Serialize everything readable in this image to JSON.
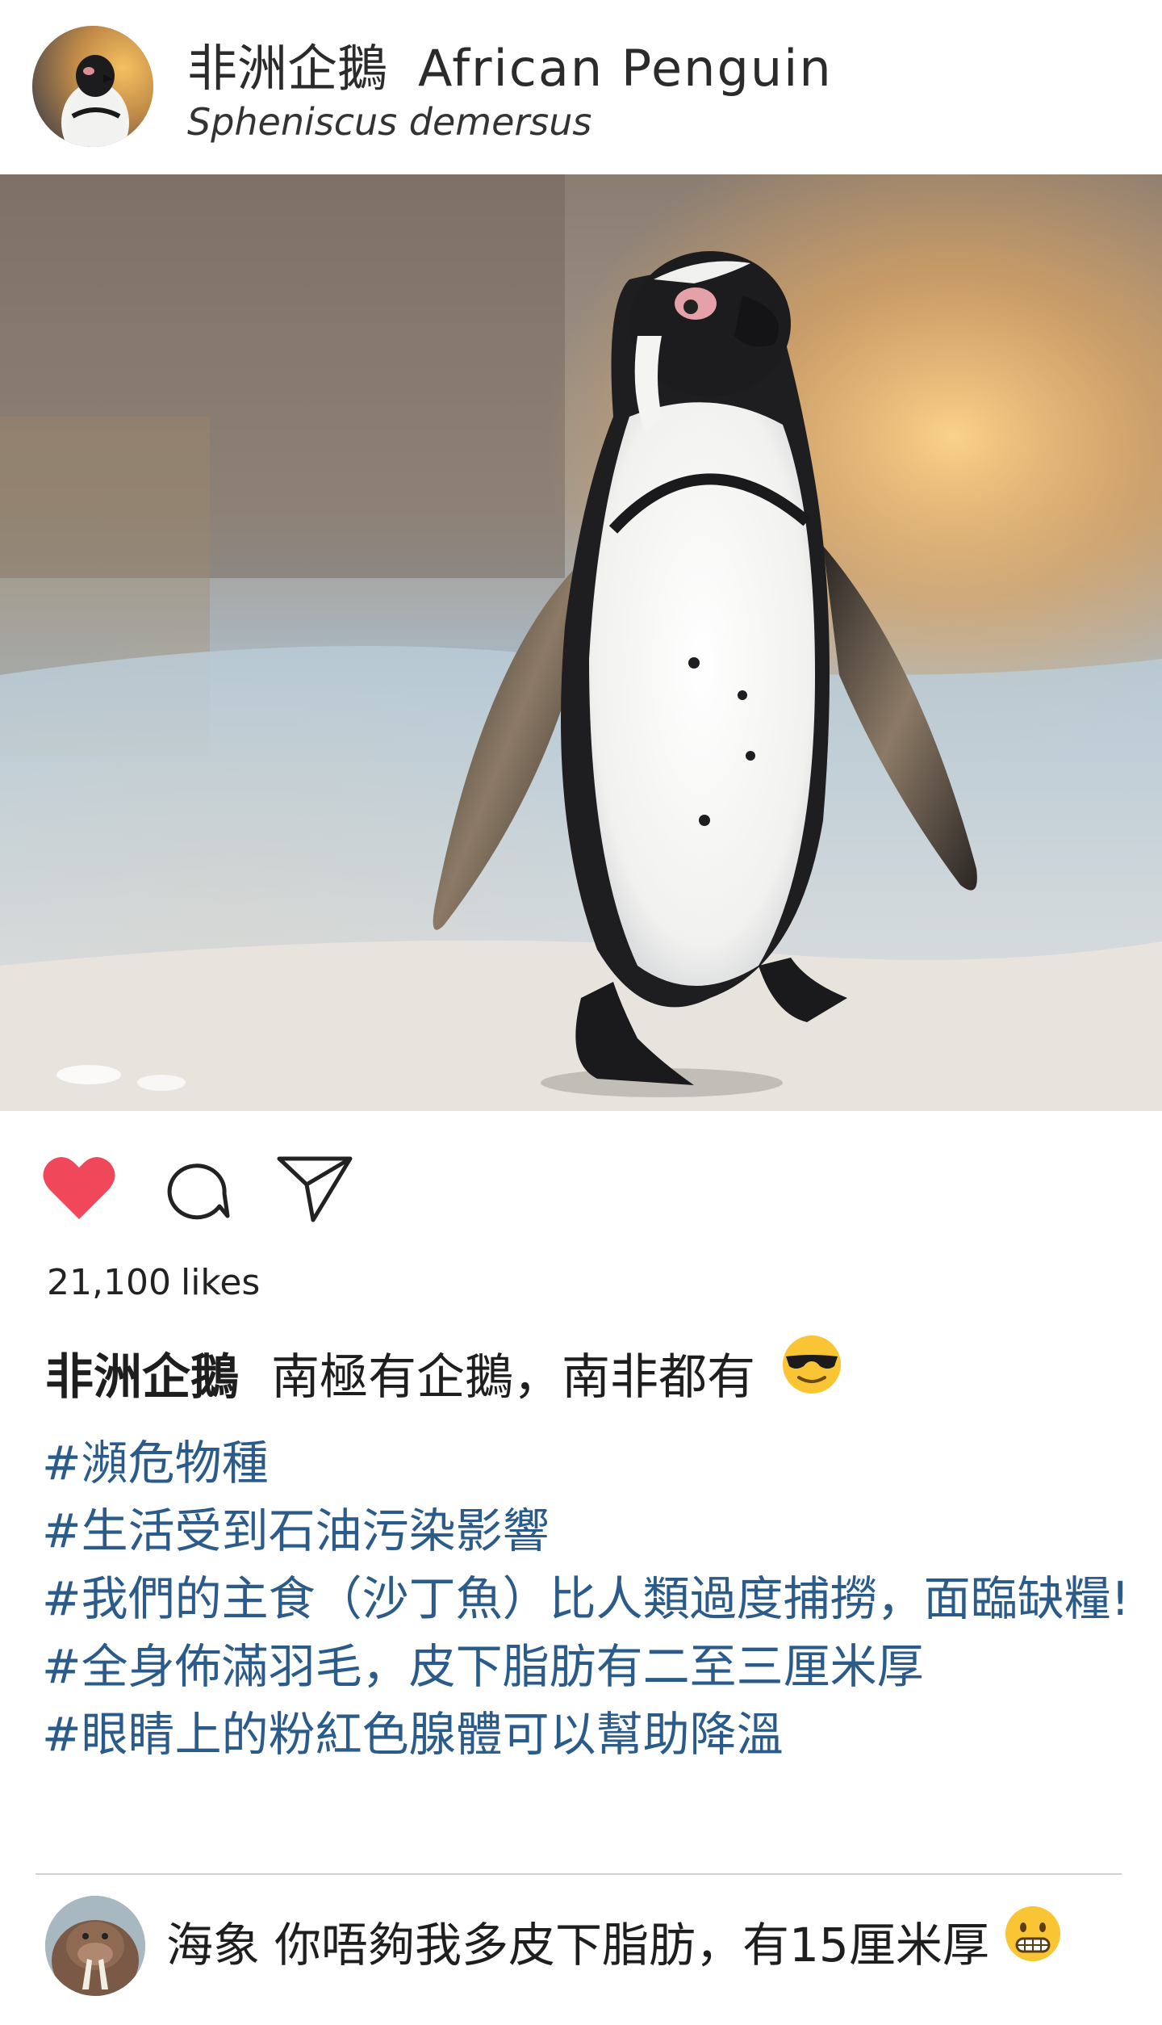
{
  "header": {
    "title_zh": "非洲企鵝",
    "title_en": "African Penguin",
    "subtitle": "Spheniscus demersus",
    "avatar_icon": "penguin-avatar"
  },
  "photo": {
    "subject": "penguin-photo"
  },
  "actions": {
    "like_icon": "heart-icon",
    "comment_icon": "comment-bubble-icon",
    "share_icon": "paper-plane-icon",
    "like_color": "#f0475a"
  },
  "likes": {
    "count": "21,100",
    "label": "likes"
  },
  "caption": {
    "author": "非洲企鵝",
    "text": "南極有企鵝，南非都有",
    "emoji": "sunglasses-face-emoji"
  },
  "hashtags": [
    "#瀕危物種",
    "#生活受到石油污染影響",
    "#我們的主食（沙丁魚）比人類過度捕撈，面臨缺糧!",
    "#全身佈滿羽毛，皮下脂肪有二至三厘米厚",
    "#眼睛上的粉紅色腺體可以幫助降溫"
  ],
  "comment": {
    "author": "海象",
    "text": "你唔夠我多皮下脂肪，有15厘米厚",
    "emoji": "grimacing-face-emoji",
    "avatar_icon": "walrus-avatar"
  },
  "colors": {
    "hashtag": "#2a5b8a",
    "text": "#1e1e1e",
    "divider": "#d0d0d0"
  }
}
